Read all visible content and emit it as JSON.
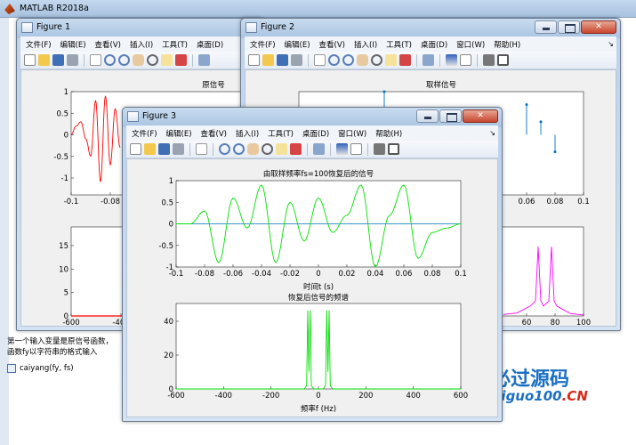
{
  "main_window": {
    "title": "MATLAB R2018a"
  },
  "command_window": {
    "line1": "第一个输入变量是原信号函数，",
    "line2": "函数fy以字符串的格式输入",
    "func_call": "caiyang(fy, fs)"
  },
  "logo": {
    "cn": "必过源码",
    "url_prefix": "Biguo100",
    "url_suffix": ".CN"
  },
  "menus": {
    "fig1": [
      "文件(F)",
      "编辑(E)",
      "查看(V)",
      "插入(I)",
      "工具(T)",
      "桌面(D)"
    ],
    "fig2": [
      "文件(F)",
      "编辑(E)",
      "查看(V)",
      "插入(I)",
      "工具(T)",
      "桌面(D)",
      "窗口(W)",
      "帮助(H)"
    ],
    "fig3": [
      "文件(F)",
      "编辑(E)",
      "查看(V)",
      "插入(I)",
      "工具(T)",
      "桌面(D)",
      "窗口(W)",
      "帮助(H)"
    ]
  },
  "figure1": {
    "title": "Figure 1",
    "plot1": {
      "title": "原信号",
      "xticks": [
        "-0.1",
        "-0.08",
        "-0.06"
      ],
      "yticks": [
        "1",
        "0.5",
        "0",
        "-0.5",
        "-1"
      ]
    },
    "plot2": {
      "xticks": [
        "-600",
        "-400"
      ],
      "yticks": [
        "15",
        "10",
        "5",
        "0"
      ]
    }
  },
  "figure2": {
    "title": "Figure 2",
    "plot1": {
      "title": "取样信号",
      "xticks": [
        "0.06",
        "0.08",
        "0.1"
      ]
    },
    "plot2": {
      "xticks": [
        "60",
        "80",
        "100"
      ]
    }
  },
  "figure3": {
    "title": "Figure 3",
    "plot1": {
      "title": "由取样频率fs=100恢复后的信号",
      "xlabel": "时间t (s)",
      "xticks": [
        "-0.1",
        "-0.08",
        "-0.06",
        "-0.04",
        "-0.02",
        "0",
        "0.02",
        "0.04",
        "0.06",
        "0.08",
        "0.1"
      ],
      "yticks": [
        "1",
        "0.5",
        "0",
        "-0.5",
        "-1"
      ]
    },
    "plot2": {
      "title": "恢复后信号的频谱",
      "xlabel": "频率f (Hz)",
      "xticks": [
        "-600",
        "-400",
        "-200",
        "0",
        "200",
        "400",
        "600"
      ],
      "yticks": [
        "40",
        "20",
        "0"
      ]
    }
  },
  "colors": {
    "red_signal": "#ff0000",
    "green_signal": "#00e000",
    "blue_stem": "#0072bd",
    "magenta_spectrum": "#ff00ff"
  },
  "chart_data": [
    {
      "type": "line",
      "title": "原信号",
      "x": [
        -0.1,
        -0.095,
        -0.09,
        -0.085,
        -0.08,
        -0.075,
        -0.07,
        -0.065,
        -0.06,
        -0.055,
        -0.05
      ],
      "xlim": [
        -0.1,
        0.1
      ],
      "ylim": [
        -1.4,
        1
      ],
      "series": [
        {
          "values": [
            0,
            0.2,
            0.3,
            -0.1,
            -0.5,
            0.8,
            -1.1,
            0.9,
            -0.7,
            0.6,
            -0.3
          ]
        }
      ]
    },
    {
      "type": "line",
      "xlim": [
        -600,
        600
      ],
      "ylim": [
        0,
        18
      ],
      "series": [
        {
          "values": []
        }
      ]
    },
    {
      "type": "bar",
      "title": "取样信号",
      "x": [
        -0.04,
        0.04,
        0.06,
        0.07,
        0.08
      ],
      "xlim": [
        -0.1,
        0.1
      ],
      "ylim": [
        -1.4,
        1
      ],
      "series": [
        {
          "values": [
            1,
            -0.5,
            0.7,
            0.3,
            -0.4
          ]
        }
      ]
    },
    {
      "type": "line",
      "x": [
        40,
        50,
        60,
        64,
        66,
        68,
        70,
        74,
        76,
        78,
        80,
        90,
        100
      ],
      "xlim": [
        40,
        100
      ],
      "ylim": [
        0,
        18
      ],
      "series": [
        {
          "values": [
            0.3,
            0.6,
            2,
            3,
            14,
            3,
            2,
            3,
            14,
            3,
            2,
            0.5,
            0.2
          ]
        }
      ]
    },
    {
      "type": "line",
      "title": "由取样频率fs=100恢复后的信号",
      "xlabel": "时间t (s)",
      "x": [
        -0.1,
        -0.09,
        -0.08,
        -0.07,
        -0.06,
        -0.05,
        -0.04,
        -0.03,
        -0.02,
        -0.01,
        0,
        0.01,
        0.02,
        0.03,
        0.04,
        0.05,
        0.06,
        0.07,
        0.08,
        0.09,
        0.1
      ],
      "xlim": [
        -0.1,
        0.1
      ],
      "ylim": [
        -1,
        1
      ],
      "series": [
        {
          "values": [
            0,
            0,
            0.3,
            -0.9,
            0.6,
            -0.1,
            0.9,
            -0.9,
            0.5,
            -0.4,
            0.6,
            -0.2,
            0.2,
            0.9,
            -1,
            0.2,
            0.9,
            -0.8,
            -0.2,
            -0.1,
            0
          ]
        }
      ]
    },
    {
      "type": "line",
      "title": "恢复后信号的频谱",
      "xlabel": "频率f (Hz)",
      "x": [
        -600,
        -60,
        -50,
        -45,
        -40,
        -35,
        -30,
        -20,
        0,
        20,
        30,
        35,
        40,
        45,
        50,
        60,
        600
      ],
      "xlim": [
        -600,
        600
      ],
      "ylim": [
        0,
        50
      ],
      "series": [
        {
          "values": [
            0,
            0,
            2,
            46,
            10,
            46,
            2,
            0,
            0,
            0,
            2,
            46,
            10,
            46,
            2,
            0,
            0
          ]
        }
      ]
    }
  ]
}
